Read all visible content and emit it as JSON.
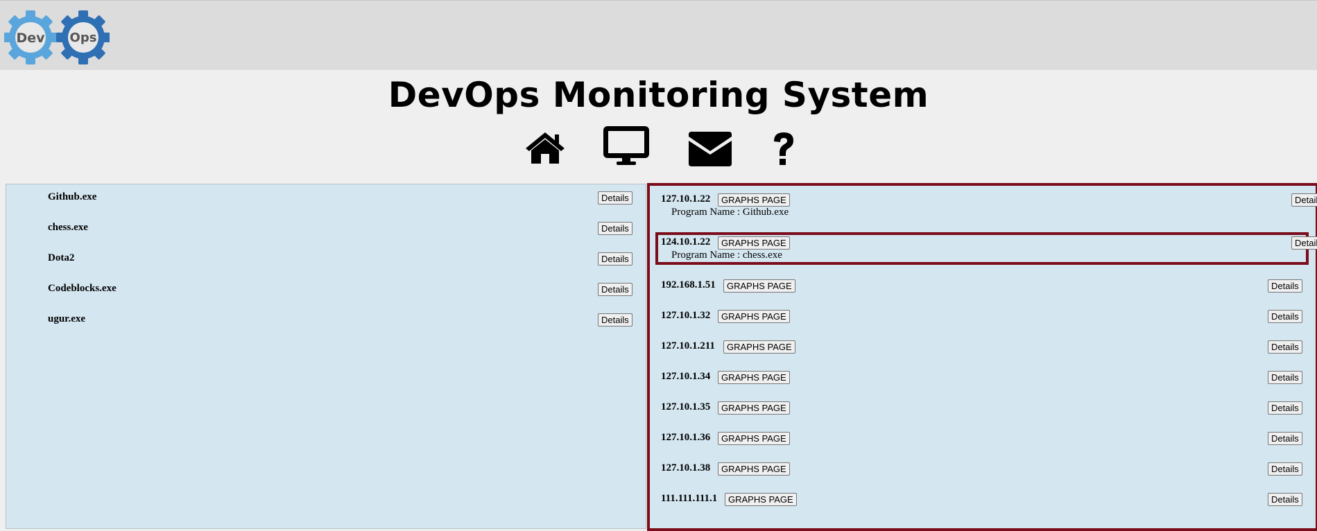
{
  "header": {
    "logo_left_text": "Dev",
    "logo_right_text": "Ops",
    "title": "DevOps Monitoring System"
  },
  "nav": {
    "icons": [
      "home-icon",
      "monitor-icon",
      "mail-icon",
      "help-icon"
    ]
  },
  "colors": {
    "panel_bg": "#d4e6f0",
    "highlight_border": "#7b0c1b",
    "logo_light_blue": "#5aa5dc",
    "logo_dark_blue": "#2f6fb4"
  },
  "programs": [
    {
      "name": "Github.exe",
      "button": "Details"
    },
    {
      "name": "chess.exe",
      "button": "Details"
    },
    {
      "name": "Dota2",
      "button": "Details"
    },
    {
      "name": "Codeblocks.exe",
      "button": "Details"
    },
    {
      "name": "ugur.exe",
      "button": "Details"
    }
  ],
  "hosts": [
    {
      "ip": "127.10.1.22",
      "graphs": "GRAPHS PAGE",
      "details": "Details",
      "program": "Program Name : Github.exe"
    },
    {
      "ip": "124.10.1.22",
      "graphs": "GRAPHS PAGE",
      "details": "Details",
      "program": "Program Name : chess.exe"
    },
    {
      "ip": "192.168.1.51",
      "graphs": "GRAPHS PAGE",
      "details": "Details",
      "program": ""
    },
    {
      "ip": "127.10.1.32",
      "graphs": "GRAPHS PAGE",
      "details": "Details",
      "program": ""
    },
    {
      "ip": "127.10.1.211",
      "graphs": "GRAPHS PAGE",
      "details": "Details",
      "program": ""
    },
    {
      "ip": "127.10.1.34",
      "graphs": "GRAPHS PAGE",
      "details": "Details",
      "program": ""
    },
    {
      "ip": "127.10.1.35",
      "graphs": "GRAPHS PAGE",
      "details": "Details",
      "program": ""
    },
    {
      "ip": "127.10.1.36",
      "graphs": "GRAPHS PAGE",
      "details": "Details",
      "program": ""
    },
    {
      "ip": "127.10.1.38",
      "graphs": "GRAPHS PAGE",
      "details": "Details",
      "program": ""
    },
    {
      "ip": "111.111.111.1",
      "graphs": "GRAPHS PAGE",
      "details": "Details",
      "program": ""
    }
  ]
}
